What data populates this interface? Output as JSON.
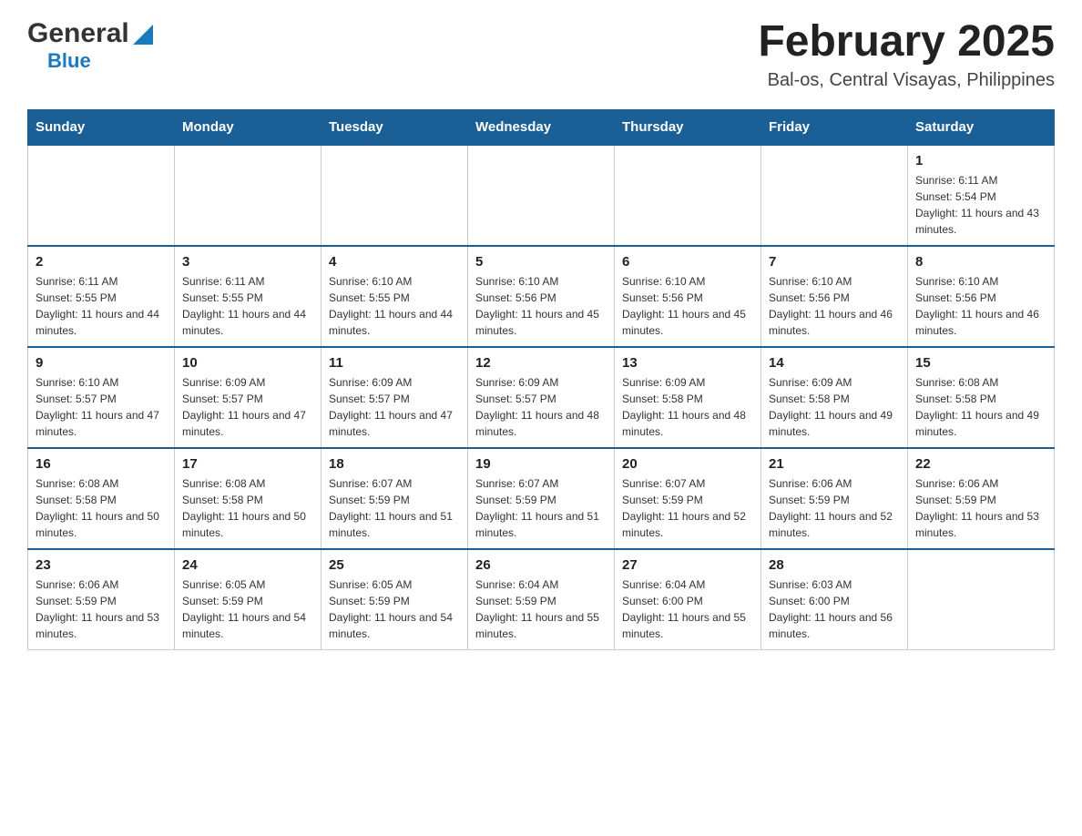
{
  "header": {
    "logo": {
      "general": "General",
      "blue": "Blue"
    },
    "title": "February 2025",
    "location": "Bal-os, Central Visayas, Philippines"
  },
  "days_of_week": [
    "Sunday",
    "Monday",
    "Tuesday",
    "Wednesday",
    "Thursday",
    "Friday",
    "Saturday"
  ],
  "weeks": [
    [
      {
        "day": "",
        "sunrise": "",
        "sunset": "",
        "daylight": "",
        "empty": true
      },
      {
        "day": "",
        "sunrise": "",
        "sunset": "",
        "daylight": "",
        "empty": true
      },
      {
        "day": "",
        "sunrise": "",
        "sunset": "",
        "daylight": "",
        "empty": true
      },
      {
        "day": "",
        "sunrise": "",
        "sunset": "",
        "daylight": "",
        "empty": true
      },
      {
        "day": "",
        "sunrise": "",
        "sunset": "",
        "daylight": "",
        "empty": true
      },
      {
        "day": "",
        "sunrise": "",
        "sunset": "",
        "daylight": "",
        "empty": true
      },
      {
        "day": "1",
        "sunrise": "Sunrise: 6:11 AM",
        "sunset": "Sunset: 5:54 PM",
        "daylight": "Daylight: 11 hours and 43 minutes.",
        "empty": false
      }
    ],
    [
      {
        "day": "2",
        "sunrise": "Sunrise: 6:11 AM",
        "sunset": "Sunset: 5:55 PM",
        "daylight": "Daylight: 11 hours and 44 minutes.",
        "empty": false
      },
      {
        "day": "3",
        "sunrise": "Sunrise: 6:11 AM",
        "sunset": "Sunset: 5:55 PM",
        "daylight": "Daylight: 11 hours and 44 minutes.",
        "empty": false
      },
      {
        "day": "4",
        "sunrise": "Sunrise: 6:10 AM",
        "sunset": "Sunset: 5:55 PM",
        "daylight": "Daylight: 11 hours and 44 minutes.",
        "empty": false
      },
      {
        "day": "5",
        "sunrise": "Sunrise: 6:10 AM",
        "sunset": "Sunset: 5:56 PM",
        "daylight": "Daylight: 11 hours and 45 minutes.",
        "empty": false
      },
      {
        "day": "6",
        "sunrise": "Sunrise: 6:10 AM",
        "sunset": "Sunset: 5:56 PM",
        "daylight": "Daylight: 11 hours and 45 minutes.",
        "empty": false
      },
      {
        "day": "7",
        "sunrise": "Sunrise: 6:10 AM",
        "sunset": "Sunset: 5:56 PM",
        "daylight": "Daylight: 11 hours and 46 minutes.",
        "empty": false
      },
      {
        "day": "8",
        "sunrise": "Sunrise: 6:10 AM",
        "sunset": "Sunset: 5:56 PM",
        "daylight": "Daylight: 11 hours and 46 minutes.",
        "empty": false
      }
    ],
    [
      {
        "day": "9",
        "sunrise": "Sunrise: 6:10 AM",
        "sunset": "Sunset: 5:57 PM",
        "daylight": "Daylight: 11 hours and 47 minutes.",
        "empty": false
      },
      {
        "day": "10",
        "sunrise": "Sunrise: 6:09 AM",
        "sunset": "Sunset: 5:57 PM",
        "daylight": "Daylight: 11 hours and 47 minutes.",
        "empty": false
      },
      {
        "day": "11",
        "sunrise": "Sunrise: 6:09 AM",
        "sunset": "Sunset: 5:57 PM",
        "daylight": "Daylight: 11 hours and 47 minutes.",
        "empty": false
      },
      {
        "day": "12",
        "sunrise": "Sunrise: 6:09 AM",
        "sunset": "Sunset: 5:57 PM",
        "daylight": "Daylight: 11 hours and 48 minutes.",
        "empty": false
      },
      {
        "day": "13",
        "sunrise": "Sunrise: 6:09 AM",
        "sunset": "Sunset: 5:58 PM",
        "daylight": "Daylight: 11 hours and 48 minutes.",
        "empty": false
      },
      {
        "day": "14",
        "sunrise": "Sunrise: 6:09 AM",
        "sunset": "Sunset: 5:58 PM",
        "daylight": "Daylight: 11 hours and 49 minutes.",
        "empty": false
      },
      {
        "day": "15",
        "sunrise": "Sunrise: 6:08 AM",
        "sunset": "Sunset: 5:58 PM",
        "daylight": "Daylight: 11 hours and 49 minutes.",
        "empty": false
      }
    ],
    [
      {
        "day": "16",
        "sunrise": "Sunrise: 6:08 AM",
        "sunset": "Sunset: 5:58 PM",
        "daylight": "Daylight: 11 hours and 50 minutes.",
        "empty": false
      },
      {
        "day": "17",
        "sunrise": "Sunrise: 6:08 AM",
        "sunset": "Sunset: 5:58 PM",
        "daylight": "Daylight: 11 hours and 50 minutes.",
        "empty": false
      },
      {
        "day": "18",
        "sunrise": "Sunrise: 6:07 AM",
        "sunset": "Sunset: 5:59 PM",
        "daylight": "Daylight: 11 hours and 51 minutes.",
        "empty": false
      },
      {
        "day": "19",
        "sunrise": "Sunrise: 6:07 AM",
        "sunset": "Sunset: 5:59 PM",
        "daylight": "Daylight: 11 hours and 51 minutes.",
        "empty": false
      },
      {
        "day": "20",
        "sunrise": "Sunrise: 6:07 AM",
        "sunset": "Sunset: 5:59 PM",
        "daylight": "Daylight: 11 hours and 52 minutes.",
        "empty": false
      },
      {
        "day": "21",
        "sunrise": "Sunrise: 6:06 AM",
        "sunset": "Sunset: 5:59 PM",
        "daylight": "Daylight: 11 hours and 52 minutes.",
        "empty": false
      },
      {
        "day": "22",
        "sunrise": "Sunrise: 6:06 AM",
        "sunset": "Sunset: 5:59 PM",
        "daylight": "Daylight: 11 hours and 53 minutes.",
        "empty": false
      }
    ],
    [
      {
        "day": "23",
        "sunrise": "Sunrise: 6:06 AM",
        "sunset": "Sunset: 5:59 PM",
        "daylight": "Daylight: 11 hours and 53 minutes.",
        "empty": false
      },
      {
        "day": "24",
        "sunrise": "Sunrise: 6:05 AM",
        "sunset": "Sunset: 5:59 PM",
        "daylight": "Daylight: 11 hours and 54 minutes.",
        "empty": false
      },
      {
        "day": "25",
        "sunrise": "Sunrise: 6:05 AM",
        "sunset": "Sunset: 5:59 PM",
        "daylight": "Daylight: 11 hours and 54 minutes.",
        "empty": false
      },
      {
        "day": "26",
        "sunrise": "Sunrise: 6:04 AM",
        "sunset": "Sunset: 5:59 PM",
        "daylight": "Daylight: 11 hours and 55 minutes.",
        "empty": false
      },
      {
        "day": "27",
        "sunrise": "Sunrise: 6:04 AM",
        "sunset": "Sunset: 6:00 PM",
        "daylight": "Daylight: 11 hours and 55 minutes.",
        "empty": false
      },
      {
        "day": "28",
        "sunrise": "Sunrise: 6:03 AM",
        "sunset": "Sunset: 6:00 PM",
        "daylight": "Daylight: 11 hours and 56 minutes.",
        "empty": false
      },
      {
        "day": "",
        "sunrise": "",
        "sunset": "",
        "daylight": "",
        "empty": true
      }
    ]
  ]
}
